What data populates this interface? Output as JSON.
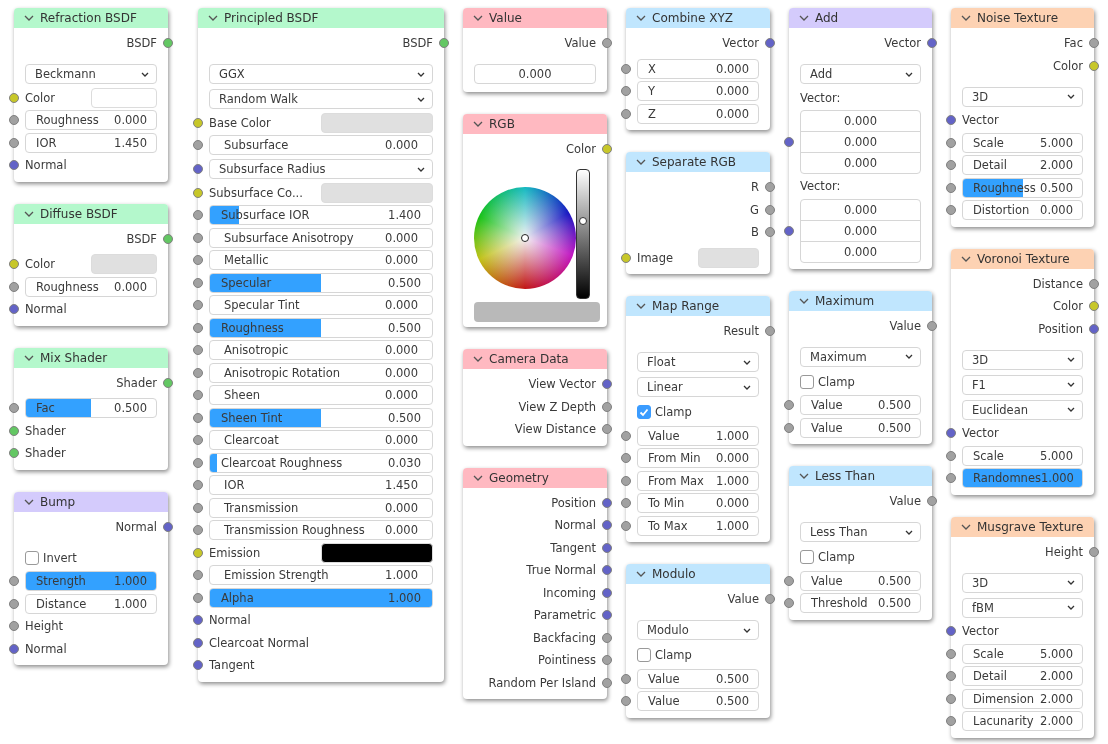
{
  "columns": [
    {
      "nodes": [
        {
          "title": "Refraction BSDF",
          "kind": "shader",
          "outputs": [
            {
              "label": "BSDF",
              "socket": {
                "color": "#63c763"
              }
            }
          ],
          "rows": [
            {
              "kind": "select",
              "value": "Beckmann"
            },
            {
              "kind": "color",
              "label": "Color",
              "color": "#ffffff",
              "socket": {
                "color": "#c7c729"
              }
            },
            {
              "kind": "number",
              "label": "Roughness",
              "value": "0.000",
              "socket": {
                "color": "#a1a1a1"
              }
            },
            {
              "kind": "number",
              "label": "IOR",
              "value": "1.450",
              "socket": {
                "color": "#a1a1a1"
              }
            },
            {
              "kind": "input",
              "label": "Normal",
              "socket": {
                "color": "#6363c7"
              }
            }
          ]
        },
        {
          "title": "Diffuse BSDF",
          "kind": "shader",
          "outputs": [
            {
              "label": "BSDF",
              "socket": {
                "color": "#63c763"
              }
            }
          ],
          "rows": [
            {
              "kind": "color",
              "label": "Color",
              "color": "#e0e0e0",
              "socket": {
                "color": "#c7c729"
              }
            },
            {
              "kind": "number",
              "label": "Roughness",
              "value": "0.000",
              "socket": {
                "color": "#a1a1a1"
              }
            },
            {
              "kind": "input",
              "label": "Normal",
              "socket": {
                "color": "#6363c7"
              }
            }
          ]
        },
        {
          "title": "Mix Shader",
          "kind": "shader",
          "outputs": [
            {
              "label": "Shader",
              "socket": {
                "color": "#63c763"
              }
            }
          ],
          "rows": [
            {
              "kind": "slider",
              "label": "Fac",
              "value": "0.500",
              "level": 0.5,
              "socket": {
                "color": "#a1a1a1"
              }
            },
            {
              "kind": "input",
              "label": "Shader",
              "socket": {
                "color": "#63c763"
              }
            },
            {
              "kind": "input",
              "label": "Shader",
              "socket": {
                "color": "#63c763"
              }
            }
          ]
        },
        {
          "title": "Bump",
          "kind": "vector",
          "outputs": [
            {
              "label": "Normal",
              "socket": {
                "color": "#6363c7"
              }
            }
          ],
          "rows": [
            {
              "kind": "checkbox",
              "label": "Invert",
              "checked": false
            },
            {
              "kind": "slider",
              "label": "Strength",
              "value": "1.000",
              "level": 1,
              "socket": {
                "color": "#a1a1a1"
              }
            },
            {
              "kind": "number",
              "label": "Distance",
              "value": "1.000",
              "socket": {
                "color": "#a1a1a1"
              }
            },
            {
              "kind": "input",
              "label": "Height",
              "socket": {
                "color": "#a1a1a1"
              }
            },
            {
              "kind": "input",
              "label": "Normal",
              "socket": {
                "color": "#6363c7"
              }
            }
          ]
        }
      ]
    },
    {
      "nodes": [
        {
          "title": "Principled BSDF",
          "kind": "shader",
          "outputs": [
            {
              "label": "BSDF",
              "socket": {
                "color": "#63c763"
              }
            }
          ],
          "rows": [
            {
              "kind": "select",
              "value": "GGX"
            },
            {
              "kind": "select",
              "value": "Random Walk"
            },
            {
              "kind": "color",
              "label": "Base Color",
              "color": "#e0e0e0",
              "socket": {
                "color": "#c7c729"
              }
            },
            {
              "kind": "number",
              "label": "Subsurface",
              "value": "0.000",
              "socket": {
                "color": "#a1a1a1"
              }
            },
            {
              "kind": "select",
              "value": "Subsurface Radius",
              "socket": {
                "color": "#6363c7"
              }
            },
            {
              "kind": "color",
              "label": "Subsurface Co...",
              "color": "#e0e0e0",
              "socket": {
                "color": "#c7c729"
              }
            },
            {
              "kind": "slider",
              "label": "Subsurface IOR",
              "value": "1.400",
              "level": 0.13,
              "socket": {
                "color": "#a1a1a1"
              }
            },
            {
              "kind": "number",
              "label": "Subsurface Anisotropy",
              "value": "0.000",
              "socket": {
                "color": "#a1a1a1"
              }
            },
            {
              "kind": "number",
              "label": "Metallic",
              "value": "0.000",
              "socket": {
                "color": "#a1a1a1"
              }
            },
            {
              "kind": "slider",
              "label": "Specular",
              "value": "0.500",
              "level": 0.5,
              "socket": {
                "color": "#a1a1a1"
              }
            },
            {
              "kind": "number",
              "label": "Specular Tint",
              "value": "0.000",
              "socket": {
                "color": "#a1a1a1"
              }
            },
            {
              "kind": "slider",
              "label": "Roughness",
              "value": "0.500",
              "level": 0.5,
              "socket": {
                "color": "#a1a1a1"
              }
            },
            {
              "kind": "number",
              "label": "Anisotropic",
              "value": "0.000",
              "socket": {
                "color": "#a1a1a1"
              }
            },
            {
              "kind": "number",
              "label": "Anisotropic Rotation",
              "value": "0.000",
              "socket": {
                "color": "#a1a1a1"
              }
            },
            {
              "kind": "number",
              "label": "Sheen",
              "value": "0.000",
              "socket": {
                "color": "#a1a1a1"
              }
            },
            {
              "kind": "slider",
              "label": "Sheen Tint",
              "value": "0.500",
              "level": 0.5,
              "socket": {
                "color": "#a1a1a1"
              }
            },
            {
              "kind": "number",
              "label": "Clearcoat",
              "value": "0.000",
              "socket": {
                "color": "#a1a1a1"
              }
            },
            {
              "kind": "slider",
              "label": "Clearcoat Roughness",
              "value": "0.030",
              "level": 0.03,
              "socket": {
                "color": "#a1a1a1"
              }
            },
            {
              "kind": "number",
              "label": "IOR",
              "value": "1.450",
              "socket": {
                "color": "#a1a1a1"
              }
            },
            {
              "kind": "number",
              "label": "Transmission",
              "value": "0.000",
              "socket": {
                "color": "#a1a1a1"
              }
            },
            {
              "kind": "number",
              "label": "Transmission Roughness",
              "value": "0.000",
              "socket": {
                "color": "#a1a1a1"
              }
            },
            {
              "kind": "color",
              "label": "Emission",
              "color": "#000000",
              "socket": {
                "color": "#c7c729"
              }
            },
            {
              "kind": "number",
              "label": "Emission Strength",
              "value": "1.000",
              "socket": {
                "color": "#a1a1a1"
              }
            },
            {
              "kind": "slider",
              "label": "Alpha",
              "value": "1.000",
              "level": 1,
              "socket": {
                "color": "#a1a1a1"
              }
            },
            {
              "kind": "input",
              "label": "Normal",
              "socket": {
                "color": "#6363c7"
              }
            },
            {
              "kind": "input",
              "label": "Clearcoat Normal",
              "socket": {
                "color": "#6363c7"
              }
            },
            {
              "kind": "input",
              "label": "Tangent",
              "socket": {
                "color": "#6363c7"
              }
            }
          ]
        }
      ]
    },
    {
      "nodes": [
        {
          "title": "Value",
          "kind": "input",
          "outputs": [
            {
              "label": "Value",
              "socket": {
                "color": "#a1a1a1"
              }
            }
          ],
          "rows": [
            {
              "kind": "value",
              "value": "0.000"
            }
          ]
        },
        {
          "title": "RGB",
          "kind": "input",
          "outputs": [
            {
              "label": "Color",
              "socket": {
                "color": "#c7c729"
              }
            }
          ],
          "rows": [
            {
              "kind": "colorwheel",
              "level": 0.6,
              "color": "#b9b9b9"
            }
          ]
        },
        {
          "title": "Camera Data",
          "kind": "input",
          "outputs": [
            {
              "label": "View Vector",
              "socket": {
                "color": "#6363c7"
              }
            },
            {
              "label": "View Z Depth",
              "socket": {
                "color": "#a1a1a1"
              }
            },
            {
              "label": "View Distance",
              "socket": {
                "color": "#a1a1a1"
              }
            }
          ]
        },
        {
          "title": "Geometry",
          "kind": "input",
          "outputs": [
            {
              "label": "Position",
              "socket": {
                "color": "#6363c7"
              }
            },
            {
              "label": "Normal",
              "socket": {
                "color": "#6363c7"
              }
            },
            {
              "label": "Tangent",
              "socket": {
                "color": "#6363c7"
              }
            },
            {
              "label": "True Normal",
              "socket": {
                "color": "#6363c7"
              }
            },
            {
              "label": "Incoming",
              "socket": {
                "color": "#6363c7"
              }
            },
            {
              "label": "Parametric",
              "socket": {
                "color": "#6363c7"
              }
            },
            {
              "label": "Backfacing",
              "socket": {
                "color": "#a1a1a1"
              }
            },
            {
              "label": "Pointiness",
              "socket": {
                "color": "#a1a1a1"
              }
            },
            {
              "label": "Random Per Island",
              "socket": {
                "color": "#a1a1a1"
              }
            }
          ]
        }
      ]
    },
    {
      "nodes": [
        {
          "title": "Combine XYZ",
          "kind": "converter",
          "outputs": [
            {
              "label": "Vector",
              "socket": {
                "color": "#6363c7"
              }
            }
          ],
          "rows": [
            {
              "kind": "number",
              "label": "X",
              "value": "0.000",
              "socket": {
                "color": "#a1a1a1"
              }
            },
            {
              "kind": "number",
              "label": "Y",
              "value": "0.000",
              "socket": {
                "color": "#a1a1a1"
              }
            },
            {
              "kind": "number",
              "label": "Z",
              "value": "0.000",
              "socket": {
                "color": "#a1a1a1"
              }
            }
          ]
        },
        {
          "title": "Separate RGB",
          "kind": "converter",
          "outputs": [
            {
              "label": "R",
              "socket": {
                "color": "#a1a1a1"
              }
            },
            {
              "label": "G",
              "socket": {
                "color": "#a1a1a1"
              }
            },
            {
              "label": "B",
              "socket": {
                "color": "#a1a1a1"
              }
            }
          ],
          "rows": [
            {
              "kind": "color",
              "label": "Image",
              "color": "#e0e0e0",
              "socket": {
                "color": "#c7c729"
              }
            }
          ]
        },
        {
          "title": "Map Range",
          "kind": "converter",
          "outputs": [
            {
              "label": "Result",
              "socket": {
                "color": "#a1a1a1"
              }
            }
          ],
          "rows": [
            {
              "kind": "select",
              "value": "Float"
            },
            {
              "kind": "select",
              "value": "Linear"
            },
            {
              "kind": "checkbox",
              "label": "Clamp",
              "checked": true
            },
            {
              "kind": "number",
              "label": "Value",
              "value": "1.000",
              "socket": {
                "color": "#a1a1a1"
              }
            },
            {
              "kind": "number",
              "label": "From Min",
              "value": "0.000",
              "socket": {
                "color": "#a1a1a1"
              }
            },
            {
              "kind": "number",
              "label": "From Max",
              "value": "1.000",
              "socket": {
                "color": "#a1a1a1"
              }
            },
            {
              "kind": "number",
              "label": "To Min",
              "value": "0.000",
              "socket": {
                "color": "#a1a1a1"
              }
            },
            {
              "kind": "number",
              "label": "To Max",
              "value": "1.000",
              "socket": {
                "color": "#a1a1a1"
              }
            }
          ]
        },
        {
          "title": "Modulo",
          "kind": "converter",
          "outputs": [
            {
              "label": "Value",
              "socket": {
                "color": "#a1a1a1"
              }
            }
          ],
          "rows": [
            {
              "kind": "select",
              "value": "Modulo"
            },
            {
              "kind": "checkbox",
              "label": "Clamp",
              "checked": false
            },
            {
              "kind": "number",
              "label": "Value",
              "value": "0.500",
              "socket": {
                "color": "#a1a1a1"
              }
            },
            {
              "kind": "number",
              "label": "Value",
              "value": "0.500",
              "socket": {
                "color": "#a1a1a1"
              }
            }
          ]
        }
      ]
    },
    {
      "nodes": [
        {
          "title": "Add",
          "kind": "vector",
          "outputs": [
            {
              "label": "Vector",
              "socket": {
                "color": "#6363c7"
              }
            }
          ],
          "rows": [
            {
              "kind": "select",
              "value": "Add"
            },
            {
              "kind": "label",
              "label": "Vector:"
            },
            {
              "kind": "vector",
              "values": [
                "0.000",
                "0.000",
                "0.000"
              ],
              "socket": {
                "color": "#6363c7"
              }
            },
            {
              "kind": "label",
              "label": "Vector:"
            },
            {
              "kind": "vector",
              "values": [
                "0.000",
                "0.000",
                "0.000"
              ],
              "socket": {
                "color": "#6363c7"
              }
            }
          ]
        },
        {
          "title": "Maximum",
          "kind": "converter",
          "outputs": [
            {
              "label": "Value",
              "socket": {
                "color": "#a1a1a1"
              }
            }
          ],
          "rows": [
            {
              "kind": "select",
              "value": "Maximum"
            },
            {
              "kind": "checkbox",
              "label": "Clamp",
              "checked": false
            },
            {
              "kind": "number",
              "label": "Value",
              "value": "0.500",
              "socket": {
                "color": "#a1a1a1"
              }
            },
            {
              "kind": "number",
              "label": "Value",
              "value": "0.500",
              "socket": {
                "color": "#a1a1a1"
              }
            }
          ]
        },
        {
          "title": "Less Than",
          "kind": "converter",
          "outputs": [
            {
              "label": "Value",
              "socket": {
                "color": "#a1a1a1"
              }
            }
          ],
          "rows": [
            {
              "kind": "select",
              "value": "Less Than"
            },
            {
              "kind": "checkbox",
              "label": "Clamp",
              "checked": false
            },
            {
              "kind": "number",
              "label": "Value",
              "value": "0.500",
              "socket": {
                "color": "#a1a1a1"
              }
            },
            {
              "kind": "number",
              "label": "Threshold",
              "value": "0.500",
              "socket": {
                "color": "#a1a1a1"
              }
            }
          ]
        }
      ]
    },
    {
      "nodes": [
        {
          "title": "Noise Texture",
          "kind": "texture",
          "outputs": [
            {
              "label": "Fac",
              "socket": {
                "color": "#a1a1a1"
              }
            },
            {
              "label": "Color",
              "socket": {
                "color": "#c7c729"
              }
            }
          ],
          "rows": [
            {
              "kind": "select",
              "value": "3D"
            },
            {
              "kind": "input",
              "label": "Vector",
              "socket": {
                "color": "#6363c7"
              }
            },
            {
              "kind": "number",
              "label": "Scale",
              "value": "5.000",
              "socket": {
                "color": "#a1a1a1"
              }
            },
            {
              "kind": "number",
              "label": "Detail",
              "value": "2.000",
              "socket": {
                "color": "#a1a1a1"
              }
            },
            {
              "kind": "slider",
              "label": "Roughness",
              "value": "0.500",
              "level": 0.5,
              "socket": {
                "color": "#a1a1a1"
              }
            },
            {
              "kind": "number",
              "label": "Distortion",
              "value": "0.000",
              "socket": {
                "color": "#a1a1a1"
              }
            }
          ]
        },
        {
          "title": "Voronoi Texture",
          "kind": "texture",
          "outputs": [
            {
              "label": "Distance",
              "socket": {
                "color": "#a1a1a1"
              }
            },
            {
              "label": "Color",
              "socket": {
                "color": "#c7c729"
              }
            },
            {
              "label": "Position",
              "socket": {
                "color": "#6363c7"
              }
            }
          ],
          "rows": [
            {
              "kind": "select",
              "value": "3D"
            },
            {
              "kind": "select",
              "value": "F1"
            },
            {
              "kind": "select",
              "value": "Euclidean"
            },
            {
              "kind": "input",
              "label": "Vector",
              "socket": {
                "color": "#6363c7"
              }
            },
            {
              "kind": "number",
              "label": "Scale",
              "value": "5.000",
              "socket": {
                "color": "#a1a1a1"
              }
            },
            {
              "kind": "slider",
              "label": "Randomnes",
              "value": "1.000",
              "level": 1,
              "socket": {
                "color": "#a1a1a1"
              }
            }
          ]
        },
        {
          "title": "Musgrave Texture",
          "kind": "texture",
          "outputs": [
            {
              "label": "Height",
              "socket": {
                "color": "#a1a1a1"
              }
            }
          ],
          "rows": [
            {
              "kind": "select",
              "value": "3D"
            },
            {
              "kind": "select",
              "value": "fBM"
            },
            {
              "kind": "input",
              "label": "Vector",
              "socket": {
                "color": "#6363c7"
              }
            },
            {
              "kind": "number",
              "label": "Scale",
              "value": "5.000",
              "socket": {
                "color": "#a1a1a1"
              }
            },
            {
              "kind": "number",
              "label": "Detail",
              "value": "2.000",
              "socket": {
                "color": "#a1a1a1"
              }
            },
            {
              "kind": "number",
              "label": "Dimension",
              "value": "2.000",
              "socket": {
                "color": "#a1a1a1"
              }
            },
            {
              "kind": "number",
              "label": "Lacunarity",
              "value": "2.000",
              "socket": {
                "color": "#a1a1a1"
              }
            }
          ]
        }
      ]
    }
  ]
}
